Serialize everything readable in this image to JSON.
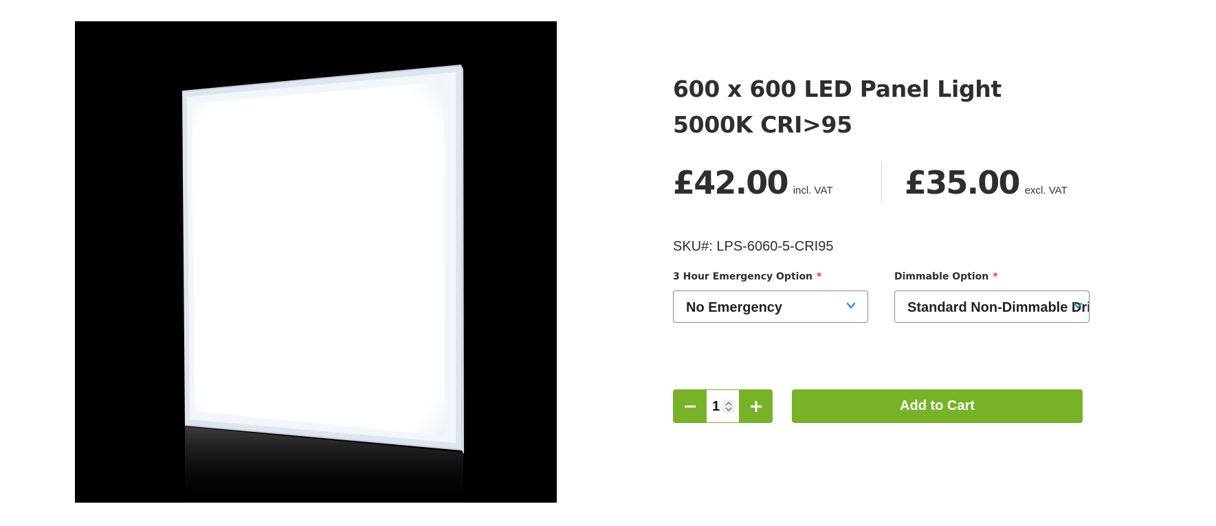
{
  "product": {
    "image_alt": "600 x 600 LED panel light on black background",
    "title": "600 x 600 LED Panel Light 5000K CRI>95",
    "sku_label": "SKU#: LPS-6060-5-CRI95"
  },
  "pricing": {
    "incl_price": "£42.00",
    "incl_label": "incl. VAT",
    "excl_price": "£35.00",
    "excl_label": "excl. VAT"
  },
  "options": {
    "emergency": {
      "label": "3 Hour Emergency Option",
      "required_mark": "*",
      "selected": "No Emergency"
    },
    "dimmable": {
      "label": "Dimmable Option",
      "required_mark": "*",
      "selected": "Standard Non-Dimmable Driver"
    }
  },
  "cart": {
    "quantity": "1",
    "add_label": "Add to Cart"
  },
  "colors": {
    "accent_green": "#77b227",
    "chevron_blue": "#2a8fd6",
    "required_red": "#e03a3a"
  },
  "icons": {
    "minus": "minus-icon",
    "plus": "plus-icon",
    "chevron": "chevron-down-icon",
    "spinner": "spinner-arrows-icon"
  }
}
